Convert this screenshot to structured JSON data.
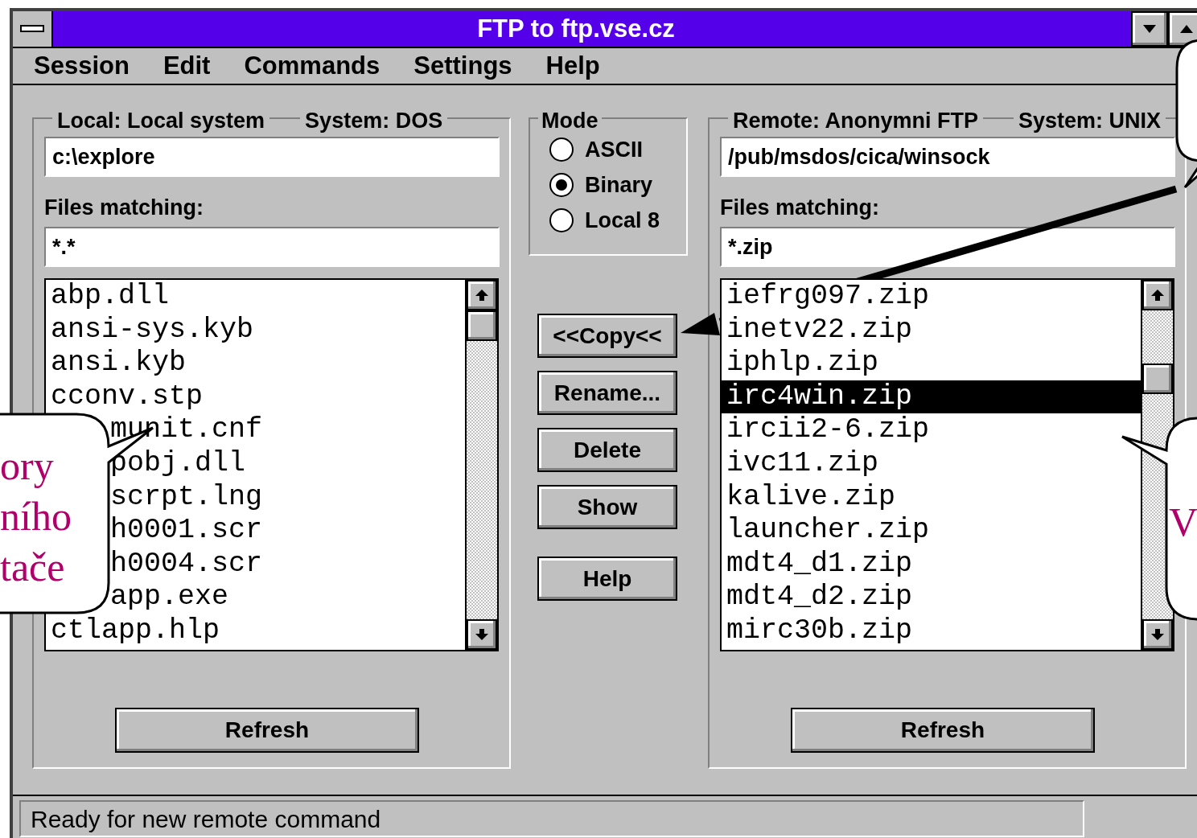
{
  "window": {
    "title": "FTP to ftp.vse.cz"
  },
  "menu": [
    "Session",
    "Edit",
    "Commands",
    "Settings",
    "Help"
  ],
  "local": {
    "label": "Local: Local system",
    "system": "System: DOS",
    "path": "c:\\explore",
    "files_label": "Files matching:",
    "filter": "*.*",
    "refresh": "Refresh",
    "files": [
      {
        "name": "abp.dll",
        "selected": false,
        "covered": false
      },
      {
        "name": "ansi-sys.kyb",
        "selected": false,
        "covered": false
      },
      {
        "name": "ansi.kyb",
        "selected": false,
        "covered": false
      },
      {
        "name": "cconv.stp",
        "selected": false,
        "covered": false
      },
      {
        "name": "munit.cnf",
        "selected": false,
        "covered": true
      },
      {
        "name": "pobj.dll",
        "selected": false,
        "covered": true
      },
      {
        "name": "scrpt.lng",
        "selected": false,
        "covered": true
      },
      {
        "name": "h0001.scr",
        "selected": false,
        "covered": true
      },
      {
        "name": "h0004.scr",
        "selected": false,
        "covered": true
      },
      {
        "name": "app.exe",
        "selected": false,
        "covered": true
      },
      {
        "name": "ctlapp.hlp",
        "selected": false,
        "covered": false
      }
    ]
  },
  "mode": {
    "label": "Mode",
    "options": [
      {
        "label": "ASCII",
        "selected": false
      },
      {
        "label": "Binary",
        "selected": true
      },
      {
        "label": "Local 8",
        "selected": false
      }
    ]
  },
  "buttons": [
    "<<Copy<<",
    "Rename...",
    "Delete",
    "Show",
    "Help"
  ],
  "remote": {
    "label": "Remote: Anonymni FTP",
    "system": "System: UNIX",
    "path": "/pub/msdos/cica/winsock",
    "files_label": "Files matching:",
    "filter": "*.zip",
    "refresh": "Refresh",
    "files": [
      {
        "name": "iefrg097.zip",
        "selected": false,
        "covered": false
      },
      {
        "name": "inetv22.zip",
        "selected": false,
        "covered": false
      },
      {
        "name": "iphlp.zip",
        "selected": false,
        "covered": false
      },
      {
        "name": "irc4win.zip",
        "selected": true,
        "covered": false
      },
      {
        "name": "ircii2-6.zip",
        "selected": false,
        "covered": false
      },
      {
        "name": "ivc11.zip",
        "selected": false,
        "covered": false
      },
      {
        "name": "kalive.zip",
        "selected": false,
        "covered": false
      },
      {
        "name": "launcher.zip",
        "selected": false,
        "covered": false
      },
      {
        "name": "mdt4_d1.zip",
        "selected": false,
        "covered": false
      },
      {
        "name": "mdt4_d2.zip",
        "selected": false,
        "covered": false
      },
      {
        "name": "mirc30b.zip",
        "selected": false,
        "covered": false
      }
    ]
  },
  "status_bar": "Ready for new remote command",
  "callouts": [
    {
      "kind": "left",
      "lines": [
        "ory",
        "ního",
        "tače"
      ]
    },
    {
      "kind": "right",
      "lines": [
        "V"
      ]
    }
  ]
}
